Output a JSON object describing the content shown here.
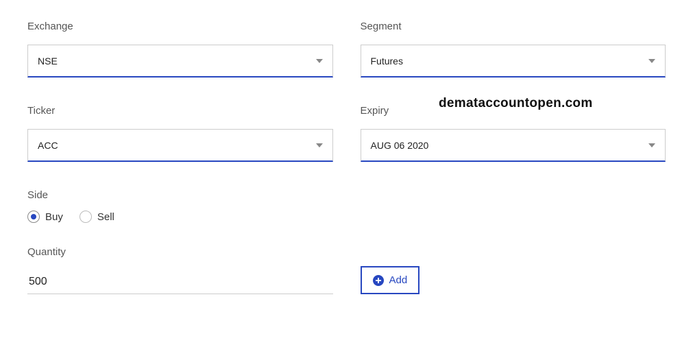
{
  "labels": {
    "exchange": "Exchange",
    "segment": "Segment",
    "ticker": "Ticker",
    "expiry": "Expiry",
    "side": "Side",
    "quantity": "Quantity"
  },
  "values": {
    "exchange": "NSE",
    "segment": "Futures",
    "ticker": "ACC",
    "expiry": "AUG 06 2020",
    "quantity": "500"
  },
  "side": {
    "buy": "Buy",
    "sell": "Sell",
    "selected": "buy"
  },
  "buttons": {
    "add": "Add"
  },
  "watermark": "demataccountopen.com"
}
